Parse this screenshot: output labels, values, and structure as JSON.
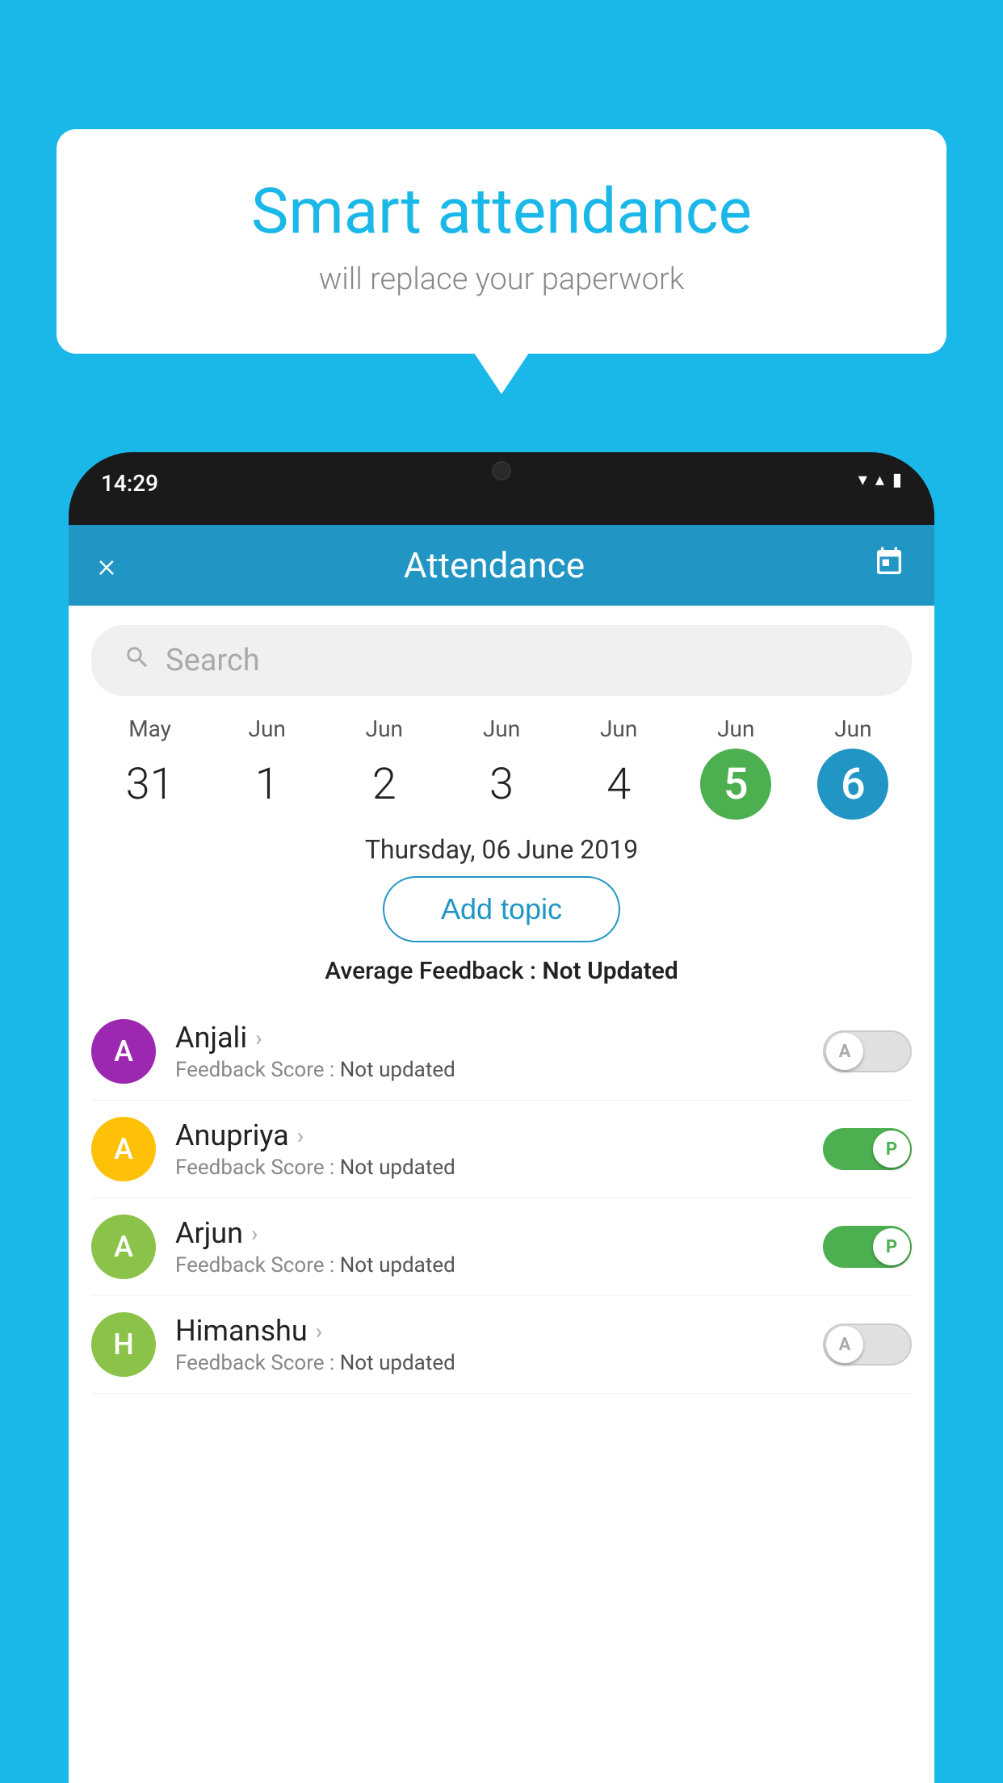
{
  "background_color": "#1ab8e8",
  "bubble": {
    "title": "Smart attendance",
    "subtitle": "will replace your paperwork"
  },
  "status_bar": {
    "time": "14:29",
    "wifi": "▼",
    "signal": "▲",
    "battery": "▮"
  },
  "header": {
    "title": "Attendance",
    "close_icon": "×",
    "calendar_icon": "📅"
  },
  "search": {
    "placeholder": "Search"
  },
  "dates": [
    {
      "month": "May",
      "day": "31",
      "state": "normal"
    },
    {
      "month": "Jun",
      "day": "1",
      "state": "normal"
    },
    {
      "month": "Jun",
      "day": "2",
      "state": "normal"
    },
    {
      "month": "Jun",
      "day": "3",
      "state": "normal"
    },
    {
      "month": "Jun",
      "day": "4",
      "state": "normal"
    },
    {
      "month": "Jun",
      "day": "5",
      "state": "today"
    },
    {
      "month": "Jun",
      "day": "6",
      "state": "selected"
    }
  ],
  "selected_date": "Thursday, 06 June 2019",
  "add_topic_label": "Add topic",
  "average_feedback": {
    "label": "Average Feedback : ",
    "value": "Not Updated"
  },
  "students": [
    {
      "name": "Anjali",
      "avatar_letter": "A",
      "avatar_color": "#9C27B0",
      "feedback_label": "Feedback Score : ",
      "feedback_value": "Not updated",
      "toggle_state": "off",
      "toggle_letter": "A"
    },
    {
      "name": "Anupriya",
      "avatar_letter": "A",
      "avatar_color": "#FFC107",
      "feedback_label": "Feedback Score : ",
      "feedback_value": "Not updated",
      "toggle_state": "on",
      "toggle_letter": "P"
    },
    {
      "name": "Arjun",
      "avatar_letter": "A",
      "avatar_color": "#8BC34A",
      "feedback_label": "Feedback Score : ",
      "feedback_value": "Not updated",
      "toggle_state": "on",
      "toggle_letter": "P"
    },
    {
      "name": "Himanshu",
      "avatar_letter": "H",
      "avatar_color": "#8BC34A",
      "feedback_label": "Feedback Score : ",
      "feedback_value": "Not updated",
      "toggle_state": "off",
      "toggle_letter": "A"
    }
  ]
}
